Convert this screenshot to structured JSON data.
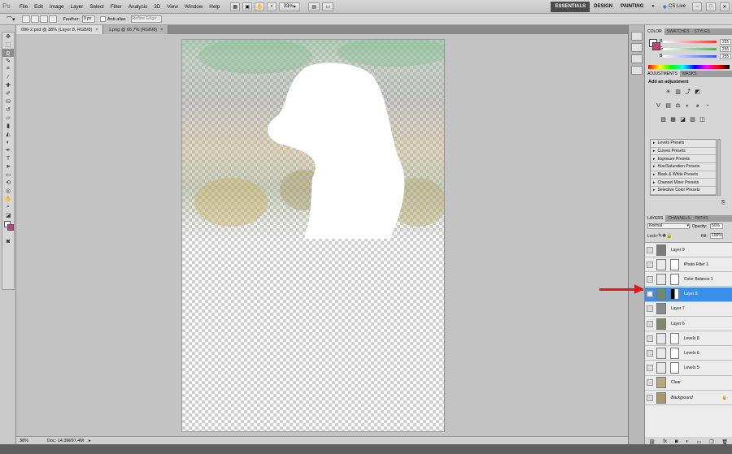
{
  "app": {
    "logo": "Ps"
  },
  "menu": [
    "File",
    "Edit",
    "Image",
    "Layer",
    "Select",
    "Filter",
    "Analysis",
    "3D",
    "View",
    "Window",
    "Help"
  ],
  "menubar": {
    "zoom": "33%",
    "workspaces": [
      "ESSENTIALS",
      "DESIGN",
      "PAINTING"
    ],
    "more": "»",
    "cslive": "CS Live"
  },
  "options": {
    "feather_label": "Feather:",
    "feather_value": "0 px",
    "antialias_label": "Anti-alias",
    "refine_edge": "Refine Edge..."
  },
  "tabs": [
    {
      "label": "096-2.psd @ 38% (Layer 8, RGB/8)",
      "active": true
    },
    {
      "label": "1.png @ 66,7% (RGB/8)",
      "active": false
    }
  ],
  "status": {
    "zoom": "38%",
    "doc": "Doc: 14.3M/97.4M"
  },
  "color_panel": {
    "tabs": [
      "COLOR",
      "SWATCHES",
      "STYLES"
    ],
    "channels": [
      {
        "label": "R",
        "value": "255",
        "color": "#e83a3a"
      },
      {
        "label": "G",
        "value": "255",
        "color": "#37c23a"
      },
      {
        "label": "B",
        "value": "255",
        "color": "#3a58e8"
      }
    ]
  },
  "adjust_panel": {
    "tabs": [
      "ADJUSTMENTS",
      "MASKS"
    ],
    "heading": "Add an adjustment",
    "presets": [
      "Levels Presets",
      "Curves Presets",
      "Exposure Presets",
      "Hue/Saturation Presets",
      "Black & White Presets",
      "Channel Mixer Presets",
      "Selective Color Presets"
    ]
  },
  "layers_panel": {
    "tabs": [
      "LAYERS",
      "CHANNELS",
      "PATHS"
    ],
    "blend": "Normal",
    "opacity_label": "Opacity:",
    "opacity": "50%",
    "lock_label": "Lock:",
    "fill_label": "Fill:",
    "fill": "100%",
    "layers": [
      {
        "name": "Layer 9",
        "visible": false,
        "mask": false,
        "selected": false
      },
      {
        "name": "Photo Filter 1",
        "visible": false,
        "mask": true,
        "selected": false
      },
      {
        "name": "Color Balance 1",
        "visible": false,
        "mask": true,
        "selected": false
      },
      {
        "name": "Layer 8",
        "visible": true,
        "mask": true,
        "selected": true
      },
      {
        "name": "Layer 7",
        "visible": false,
        "mask": false,
        "selected": false
      },
      {
        "name": "Layer 6",
        "visible": false,
        "mask": false,
        "selected": false
      },
      {
        "name": "Levels 8",
        "visible": false,
        "mask": true,
        "selected": false
      },
      {
        "name": "Levels 6",
        "visible": false,
        "mask": true,
        "selected": false
      },
      {
        "name": "Levels 5",
        "visible": false,
        "mask": true,
        "selected": false
      },
      {
        "name": "Clear",
        "visible": false,
        "mask": false,
        "selected": false
      },
      {
        "name": "Background",
        "visible": false,
        "mask": false,
        "selected": false
      }
    ]
  },
  "colors": {
    "accent": "#3a8fe8",
    "arrow": "#e01818"
  }
}
